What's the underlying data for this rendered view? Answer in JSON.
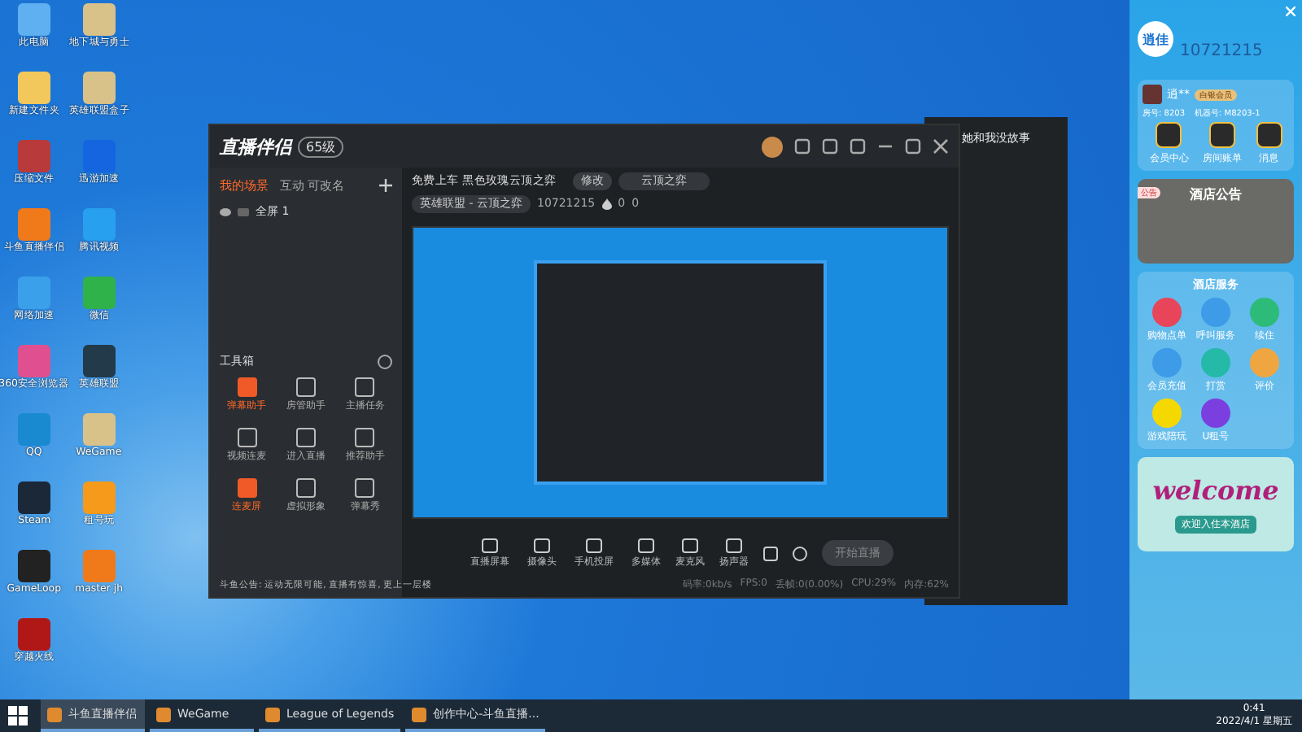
{
  "desktop_icons": [
    {
      "label": "此电脑",
      "kind": "pc"
    },
    {
      "label": "地下城与勇士",
      "kind": "game"
    },
    {
      "label": "新建文件夹",
      "kind": "folder"
    },
    {
      "label": "英雄联盟盒子",
      "kind": "game"
    },
    {
      "label": "压缩文件",
      "kind": "rar"
    },
    {
      "label": "迅游加速",
      "kind": "blue"
    },
    {
      "label": "斗鱼直播伴侣",
      "kind": "orange"
    },
    {
      "label": "腾讯视频",
      "kind": "video"
    },
    {
      "label": "网络加速",
      "kind": "cloud"
    },
    {
      "label": "微信",
      "kind": "wechat"
    },
    {
      "label": "360安全浏览器",
      "kind": "ring"
    },
    {
      "label": "英雄联盟",
      "kind": "lol"
    },
    {
      "label": "QQ",
      "kind": "qq"
    },
    {
      "label": "WeGame",
      "kind": "game"
    },
    {
      "label": "Steam",
      "kind": "steam"
    },
    {
      "label": "租号玩",
      "kind": "zu"
    },
    {
      "label": "GameLoop",
      "kind": "g"
    },
    {
      "label": "master jh",
      "kind": "orange"
    },
    {
      "label": "穿越火线",
      "kind": "cf"
    }
  ],
  "app": {
    "logo": "直播伴侣",
    "level": "65级",
    "tabs": [
      {
        "label": "我的场景",
        "selected": true
      },
      {
        "label": "互动",
        "selected": false
      },
      {
        "label": "可改名",
        "selected": false
      }
    ],
    "scene": "全屏 1",
    "room_title": "免费上车 黑色玫瑰云顶之弈",
    "edit_button": "修改",
    "game_field": "云顶之弈",
    "category": "英雄联盟 - 云顶之弈",
    "room_id": "10721215",
    "hot": "0",
    "fans": "0",
    "toolbox_title": "工具箱",
    "tools": [
      {
        "label": "弹幕助手",
        "active": true
      },
      {
        "label": "房管助手",
        "active": false
      },
      {
        "label": "主播任务",
        "active": false
      },
      {
        "label": "视频连麦",
        "active": false
      },
      {
        "label": "进入直播",
        "active": false
      },
      {
        "label": "推荐助手",
        "active": false
      },
      {
        "label": "连麦屏",
        "active": true
      },
      {
        "label": "虚拟形象",
        "active": false
      },
      {
        "label": "弹幕秀",
        "active": false
      }
    ],
    "notice": "斗鱼公告: 运动无限可能, 直播有惊喜, 更上一层楼",
    "controls": [
      "直播屏幕",
      "摄像头",
      "手机投屏",
      "多媒体",
      "麦克风",
      "扬声器"
    ],
    "start_button": "开始直播",
    "stats": [
      "码率:0kb/s",
      "FPS:0",
      "丢帧:0(0.00%)",
      "CPU:29%",
      "内存:62%"
    ]
  },
  "chat": {
    "user": "她和我没故事"
  },
  "hotel": {
    "brand": "逍佳",
    "number": "10721215",
    "user": "逍**",
    "badge": "白银会员",
    "room": "房号: 8203",
    "machine": "机器号: M8203-1",
    "quick": [
      "会员中心",
      "房间账单",
      "消息"
    ],
    "notice_tag": "公告",
    "notice_title": "酒店公告",
    "service_title": "酒店服务",
    "services": [
      {
        "label": "购物点单",
        "color": "#e8445a"
      },
      {
        "label": "呼叫服务",
        "color": "#3d9be8"
      },
      {
        "label": "续住",
        "color": "#2dbb7a"
      },
      {
        "label": "会员充值",
        "color": "#3d9be8"
      },
      {
        "label": "打赏",
        "color": "#25b9a8"
      },
      {
        "label": "评价",
        "color": "#f0a640"
      },
      {
        "label": "游戏陪玩",
        "color": "#f5d800"
      },
      {
        "label": "U租号",
        "color": "#7b3fe0"
      }
    ],
    "welcome": "welcome",
    "welcome_text": "欢迎入住本酒店"
  },
  "taskbar": {
    "items": [
      {
        "label": "斗鱼直播伴侣",
        "selected": true
      },
      {
        "label": "WeGame",
        "selected": false
      },
      {
        "label": "League of Legends",
        "selected": false
      },
      {
        "label": "创作中心-斗鱼直播...",
        "selected": false
      }
    ],
    "time": "0:41",
    "date": "2022/4/1 星期五"
  }
}
